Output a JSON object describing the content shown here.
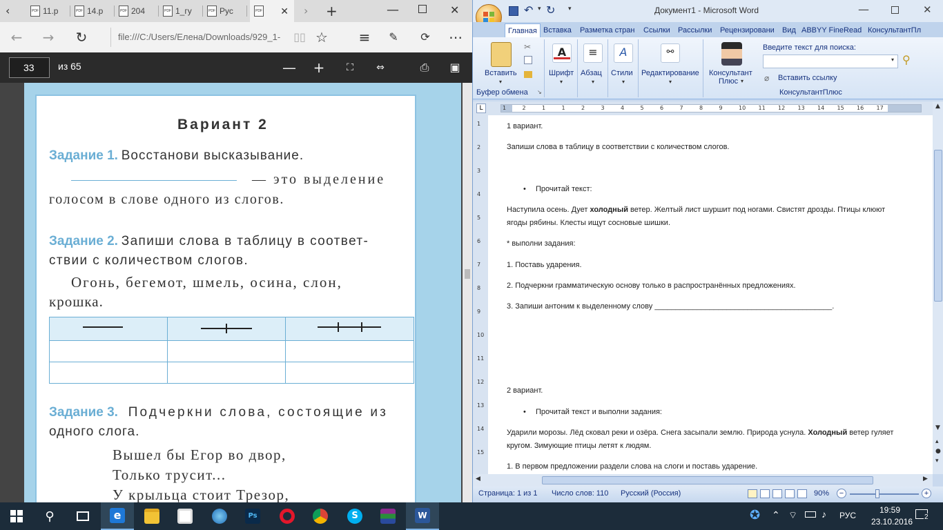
{
  "edge": {
    "tabs": [
      {
        "label": "11.р"
      },
      {
        "label": "14.р"
      },
      {
        "label": "204"
      },
      {
        "label": "1_гу"
      },
      {
        "label": "Рус"
      },
      {
        "label": ""
      }
    ],
    "url": "file:///C:/Users/Елена/Downloads/929_1-",
    "pdf_toolbar": {
      "page": "33",
      "page_count": "из 65"
    },
    "page": {
      "heading": "Вариант 2",
      "task1_label": "Задание 1.",
      "task1_text": "Восстанови высказывание.",
      "task1_line2": "— это выделение",
      "task1_line3": "голосом в слове одного из слогов.",
      "task2_label": "Задание 2.",
      "task2_text": "Запиши слова в таблицу в соответ-",
      "task2_line2": "ствии с количеством слогов.",
      "task2_words1": "Огонь, бегемот, шмель, осина, слон,",
      "task2_words2": "крошка.",
      "task3_label": "Задание 3.",
      "task3_text": "Подчеркни слова, состоящие из",
      "task3_line2": "одного слога.",
      "poem": [
        "Вышел бы Егор во двор,",
        "Только трусит...",
        "У крыльца стоит Трезор,"
      ]
    }
  },
  "word": {
    "title": "Документ1 - Microsoft Word",
    "tabs": [
      "Главная",
      "Вставка",
      "Разметка стран",
      "Ссылки",
      "Рассылки",
      "Рецензировани",
      "Вид",
      "ABBYY FineRead",
      "КонсультантПл"
    ],
    "ribbon": {
      "paste": "Вставить",
      "font": "Шрифт",
      "paragraph": "Абзац",
      "styles": "Стили",
      "editing": "Редактирование",
      "consultant": "Консультант",
      "consultant2": "Плюс",
      "clipboard": "Буфер обмена",
      "search_label": "Введите текст для поиска:",
      "insert_link": "Вставить ссылку",
      "consultant_group": "КонсультантПлюс"
    },
    "ruler_numbers": [
      "1",
      "2",
      "1",
      "1",
      "2",
      "3",
      "4",
      "5",
      "6",
      "7",
      "8",
      "9",
      "10",
      "11",
      "12",
      "13",
      "14",
      "15",
      "16",
      "17"
    ],
    "vruler_numbers": [
      "1",
      "2",
      "3",
      "4",
      "5",
      "6",
      "7",
      "8",
      "9",
      "10",
      "11",
      "12",
      "13",
      "14",
      "15"
    ],
    "doc": {
      "p1": "1 вариант.",
      "p2": "Запиши слова в таблицу в соответствии с количеством слогов.",
      "p3": "Прочитай текст:",
      "p4a": "Наступила осень. Дует ",
      "p4b": "холодный",
      "p4c": " ветер. Желтый лист шуршит под ногами. Свистят дрозды. Птицы клюют ягоды рябины. Клесты ищут сосновые шишки.",
      "p5": "* выполни задания:",
      "p6": "1. Поставь ударения.",
      "p7": "2. Подчеркни грамматическую основу только в распространённых предложениях.",
      "p8": "3.  Запиши антоним к выделенному слову __________________________________________.",
      "p9": "2 вариант.",
      "p10": "Прочитай текст и выполни задания:",
      "p11a": "Ударили морозы. Лёд сковал реки и озёра. Снега засыпали землю. Природа уснула. ",
      "p11b": "Холодный",
      "p11c": " ветер гуляет кругом. Зимующие птицы летят к людям.",
      "p12": "1. В первом предложении раздели слова на слоги и поставь ударение."
    },
    "status": {
      "page": "Страница: 1 из 1",
      "words": "Число слов: 110",
      "lang": "Русский (Россия)",
      "zoom": "90%"
    }
  },
  "taskbar": {
    "lang": "РУС",
    "time": "19:59",
    "date": "23.10.2016",
    "notif_count": "2"
  }
}
